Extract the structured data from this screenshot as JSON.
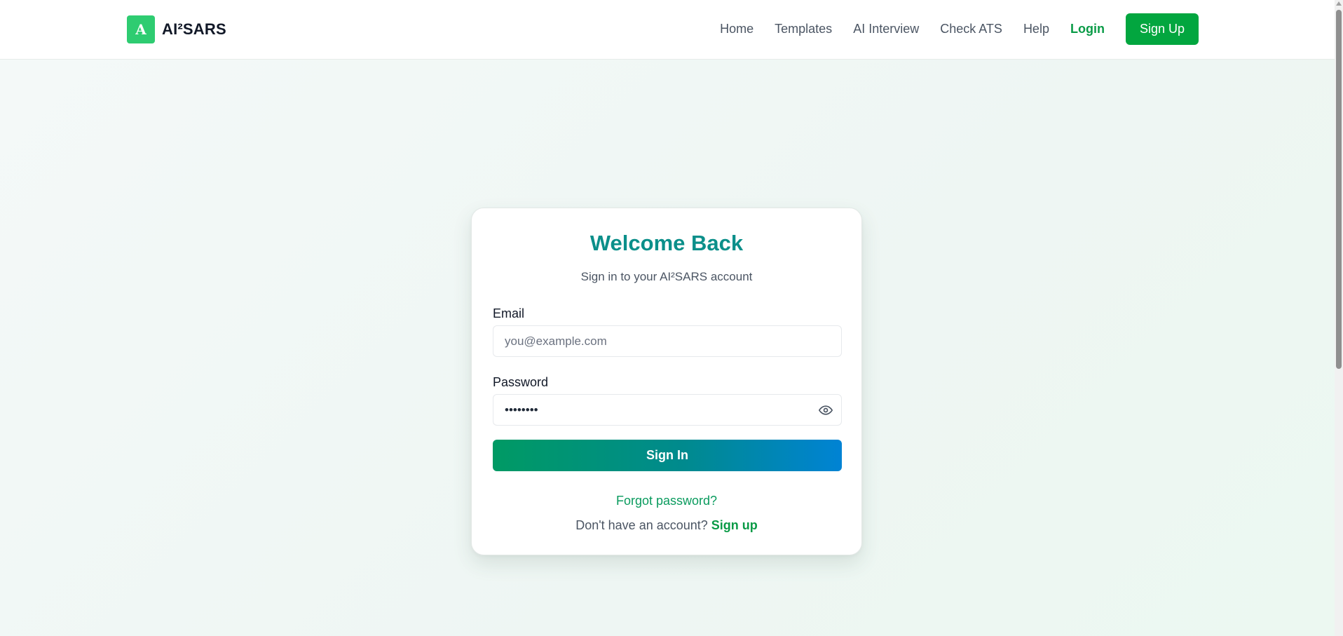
{
  "header": {
    "brand_logo_letter": "A",
    "brand_name": "AI²SARS",
    "nav": {
      "home": "Home",
      "templates": "Templates",
      "ai_interview": "AI Interview",
      "check_ats": "Check ATS",
      "help": "Help",
      "login": "Login",
      "signup": "Sign Up"
    }
  },
  "login_card": {
    "title": "Welcome Back",
    "subtitle": "Sign in to your AI²SARS account",
    "email": {
      "label": "Email",
      "placeholder": "you@example.com",
      "value": ""
    },
    "password": {
      "label": "Password",
      "value": "********",
      "toggle_icon": "eye-icon"
    },
    "signin_label": "Sign In",
    "forgot_label": "Forgot password?",
    "no_account_text": "Don't have an account?",
    "signup_link": "Sign up"
  },
  "colors": {
    "brand_green": "#02a63f",
    "title_teal": "#0b8f8a",
    "logo_green": "#2ecc71",
    "button_gradient_start": "#009a64",
    "button_gradient_end": "#0083d4"
  }
}
